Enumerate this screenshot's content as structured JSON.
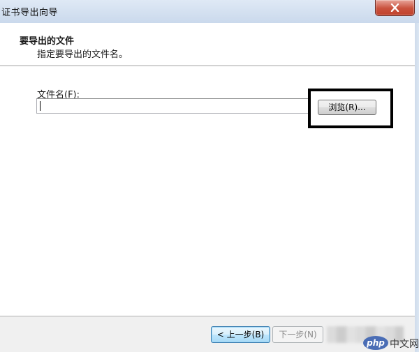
{
  "window": {
    "title": "证书导出向导",
    "close_icon": "close-icon"
  },
  "header": {
    "title": "要导出的文件",
    "subtitle": "指定要导出的文件名。"
  },
  "form": {
    "file_label": "文件名(F):",
    "file_value": "",
    "browse_label": "浏览(R)..."
  },
  "footer": {
    "back_label": "< 上一步(B)",
    "next_label": "下一步(N)"
  },
  "watermark": {
    "logo_text": "php",
    "site_text": "中文网"
  },
  "colors": {
    "title_bar": "#cad9ec",
    "close_button": "#c9513c",
    "highlight_border": "#000000",
    "back_button_focus": "#3c7fb1"
  }
}
